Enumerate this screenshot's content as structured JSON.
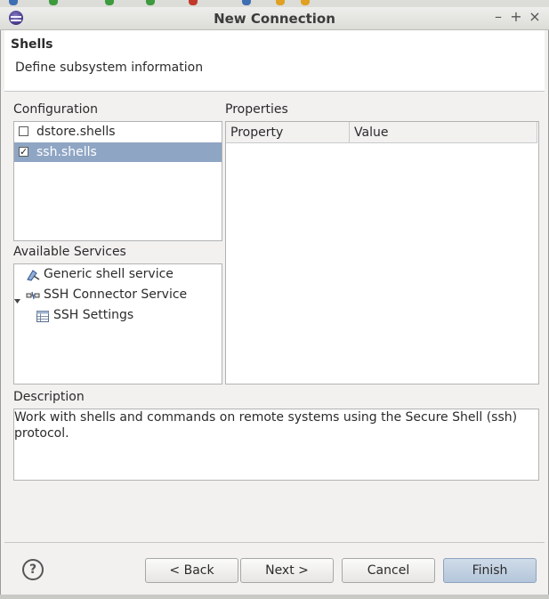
{
  "window": {
    "title": "New Connection"
  },
  "window_controls": {
    "minimize": "–",
    "maximize": "+",
    "close": "×"
  },
  "banner": {
    "title": "Shells",
    "description": "Define subsystem information"
  },
  "configuration": {
    "label": "Configuration",
    "items": [
      {
        "label": "dstore.shells",
        "checked": false,
        "selected": false
      },
      {
        "label": "ssh.shells",
        "checked": true,
        "selected": true
      }
    ]
  },
  "properties": {
    "label": "Properties",
    "columns": [
      "Property",
      "Value"
    ]
  },
  "services": {
    "label": "Available Services",
    "items": [
      {
        "label": "Generic shell service",
        "icon": "shell-service-icon"
      },
      {
        "label": "SSH Connector Service",
        "icon": "connector-icon",
        "expanded": true
      },
      {
        "label": "SSH Settings",
        "icon": "settings-table-icon"
      }
    ]
  },
  "description": {
    "label": "Description",
    "text": "Work with shells and commands on remote systems using the Secure Shell (ssh) protocol."
  },
  "buttons": {
    "help": "?",
    "back": "< Back",
    "next": "Next >",
    "cancel": "Cancel",
    "finish": "Finish"
  },
  "colors": {
    "selection": "#8fa5c4",
    "primary_button": "#bfcfe2"
  }
}
